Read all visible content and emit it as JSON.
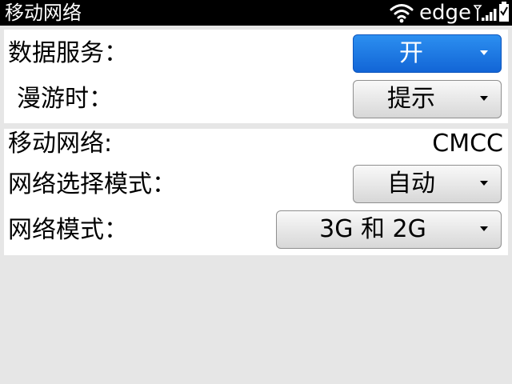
{
  "statusbar": {
    "app_title": "移动网络",
    "network_type": "edge"
  },
  "panel_data": {
    "data_service_label": "数据服务：",
    "data_service_value": "开",
    "roaming_label": "漫游时：",
    "roaming_value": "提示"
  },
  "panel_network": {
    "mobile_network_label": "移动网络:",
    "mobile_network_value": "CMCC",
    "network_selection_label": "网络选择模式：",
    "network_selection_value": "自动",
    "network_mode_label": "网络模式：",
    "network_mode_value": "3G 和 2G"
  },
  "colors": {
    "accent": "#1a74e0",
    "background": "#e6e6e6",
    "statusbar": "#000000"
  },
  "icons": [
    "wifi-icon",
    "signal-strength-icon",
    "battery-icon",
    "chevron-down-icon"
  ]
}
